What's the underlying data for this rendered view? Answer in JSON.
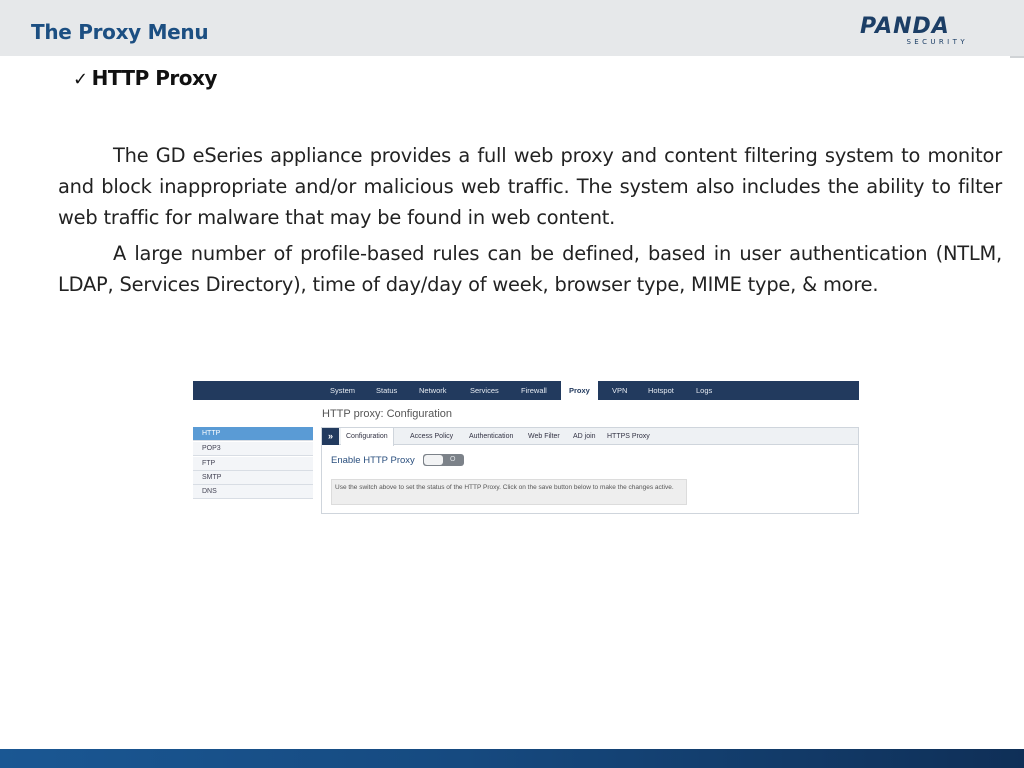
{
  "slide": {
    "title": "The Proxy Menu",
    "logo": {
      "main": "PANDA",
      "sub": "SECURITY"
    },
    "section_heading": "HTTP Proxy",
    "check_icon": "checkmark-icon",
    "paragraphs": [
      "The GD eSeries appliance provides a full web proxy and content filtering system to monitor and block inappropriate and/or malicious web traffic. The system also includes the ability to filter web traffic for malware that may be found in web content.",
      "A large number of profile-based rules can be defined, based in user authentication (NTLM, LDAP,  Services Directory), time of day/day of week, browser type, MIME type, & more."
    ]
  },
  "screenshot": {
    "nav_items": [
      "System",
      "Status",
      "Network",
      "Services",
      "Firewall",
      "Proxy",
      "VPN",
      "Hotspot",
      "Logs"
    ],
    "active_nav": "Proxy",
    "heading": "HTTP proxy: Configuration",
    "side_items": [
      "HTTP",
      "POP3",
      "FTP",
      "SMTP",
      "DNS"
    ],
    "active_side": "HTTP",
    "tab_arrow": "»",
    "tabs": [
      "Configuration",
      "Access Policy",
      "Authentication",
      "Web Filter",
      "AD join",
      "HTTPS Proxy"
    ],
    "active_tab": "Configuration",
    "enable_label": "Enable HTTP Proxy",
    "toggle_state": "off",
    "toggle_mark": "O",
    "help_text": "Use the switch above to set the status of the HTTP Proxy. Click on the save button below to make the changes active."
  },
  "colors": {
    "title": "#1c4f82",
    "nav_bar": "#223a5e",
    "side_active": "#5a9bd5",
    "footer": "#164a80"
  }
}
